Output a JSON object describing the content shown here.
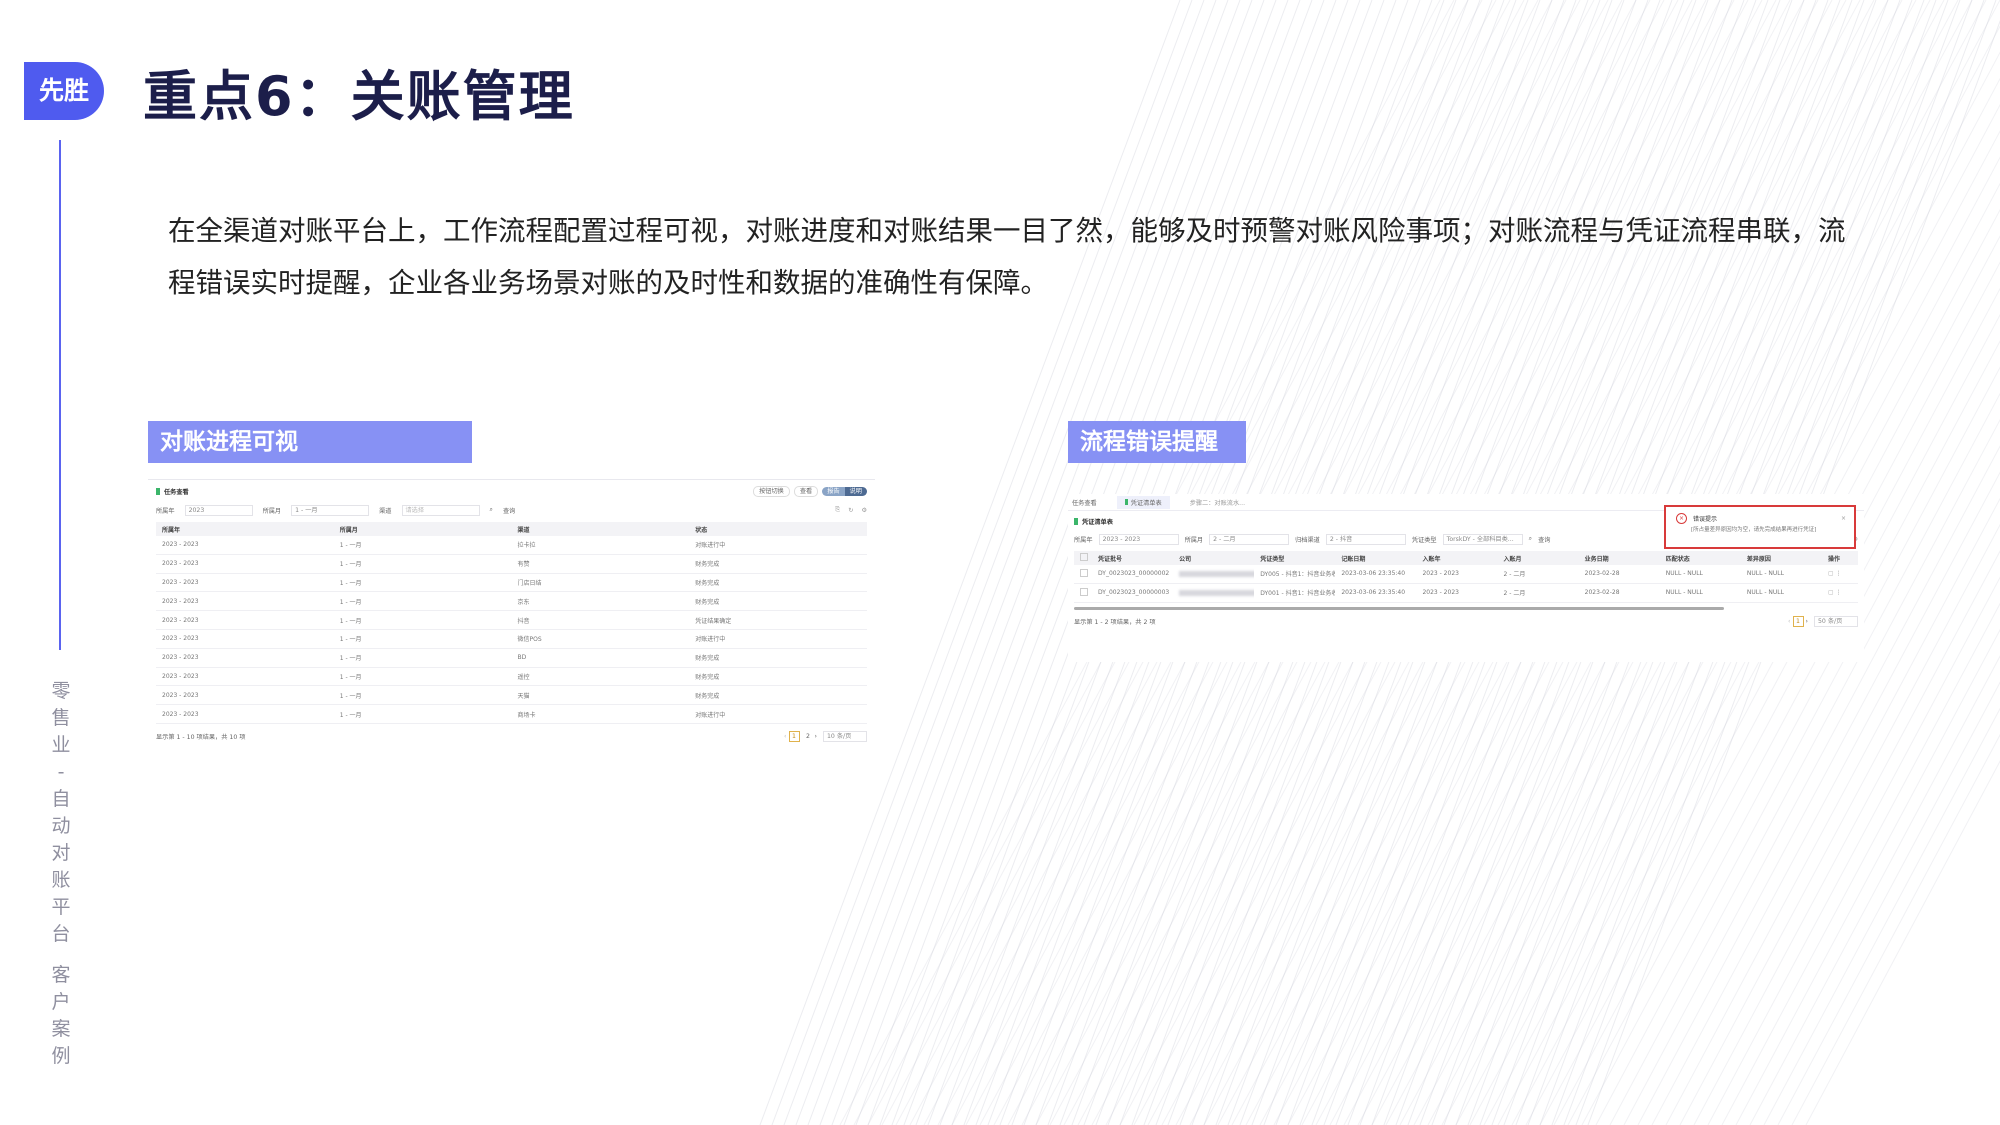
{
  "logo": {
    "text": "先胜"
  },
  "title": "重点6：关账管理",
  "sidebar_text": [
    "零",
    "售",
    "业",
    "-",
    "自",
    "动",
    "对",
    "账",
    "平",
    "台",
    "",
    "客",
    "户",
    "案",
    "例"
  ],
  "intro": "在全渠道对账平台上，工作流程配置过程可视，对账进度和对账结果一目了然，能够及时预警对账风险事项；对账流程与凭证流程串联，流程错误实时提醒，企业各业务场景对账的及时性和数据的准确性有保障。",
  "left_panel": {
    "tag": "对账进程可视",
    "header_title": "任务查看",
    "header_btns": [
      "按钮切换",
      "查看",
      "报告",
      "说明"
    ],
    "filters": [
      {
        "label": "所属年",
        "value": "2023"
      },
      {
        "label": "所属月",
        "value": "1 - 一月"
      },
      {
        "label": "渠道",
        "value": "请选择"
      }
    ],
    "search_label": "查询",
    "columns": [
      "所属年",
      "所属月",
      "渠道",
      "状态"
    ],
    "rows": [
      [
        "2023 - 2023",
        "1 - 一月",
        "拉卡拉",
        "对账进行中"
      ],
      [
        "2023 - 2023",
        "1 - 一月",
        "有赞",
        "财务完成"
      ],
      [
        "2023 - 2023",
        "1 - 一月",
        "门店日结",
        "财务完成"
      ],
      [
        "2023 - 2023",
        "1 - 一月",
        "京东",
        "财务完成"
      ],
      [
        "2023 - 2023",
        "1 - 一月",
        "抖音",
        "凭证结果确定"
      ],
      [
        "2023 - 2023",
        "1 - 一月",
        "微信POS",
        "对账进行中"
      ],
      [
        "2023 - 2023",
        "1 - 一月",
        "BD",
        "财务完成"
      ],
      [
        "2023 - 2023",
        "1 - 一月",
        "遥控",
        "财务完成"
      ],
      [
        "2023 - 2023",
        "1 - 一月",
        "天猫",
        "财务完成"
      ],
      [
        "2023 - 2023",
        "1 - 一月",
        "商场卡",
        "对账进行中"
      ]
    ],
    "footer": "显示第 1 - 10 项结果，共 10 项",
    "pages": [
      "1",
      "2"
    ],
    "page_size": "10 条/页"
  },
  "right_panel": {
    "tag": "流程错误提醒",
    "tabs": [
      "任务查看",
      "凭证清单表",
      "步骤二：对账流水..."
    ],
    "header_title": "凭证清单表",
    "filters": [
      {
        "label": "所属年",
        "value": "2023 - 2023"
      },
      {
        "label": "所属月",
        "value": "2 - 二月"
      },
      {
        "label": "归档渠道",
        "value": "2 - 抖音"
      },
      {
        "label": "凭证类型",
        "value": "TorskDY - 全部科目类..."
      }
    ],
    "search_label": "查询",
    "columns": [
      "凭证批号",
      "公司",
      "凭证类型",
      "记账日期",
      "入账年",
      "入账月",
      "业务日期",
      "匹配状态",
      "差异原因",
      "操作"
    ],
    "rows": [
      [
        "DY_0023023_00000002",
        "",
        "DY005 - 抖音1：抖音业务收入凭款",
        "2023-03-06 23:35:40",
        "2023 - 2023",
        "2 - 二月",
        "2023-02-28",
        "NULL - NULL",
        "NULL - NULL",
        ""
      ],
      [
        "DY_0023023_00000003",
        "",
        "DY001 - 抖音1：抖音业务收款凭",
        "2023-03-06 23:35:40",
        "2023 - 2023",
        "2 - 二月",
        "2023-02-28",
        "NULL - NULL",
        "NULL - NULL",
        ""
      ]
    ],
    "footer": "显示第 1 - 2 项结果，共 2 项",
    "pages": [
      "1"
    ],
    "page_size": "50 条/页",
    "error": {
      "title": "错误提示",
      "message": "[所占量差异原因均为空，请先完成结果再进行凭证]"
    }
  },
  "colors": {
    "accent": "#4f5bef",
    "tag": "#8791f4",
    "title": "#1c1e4a",
    "error": "#d83a3a"
  }
}
